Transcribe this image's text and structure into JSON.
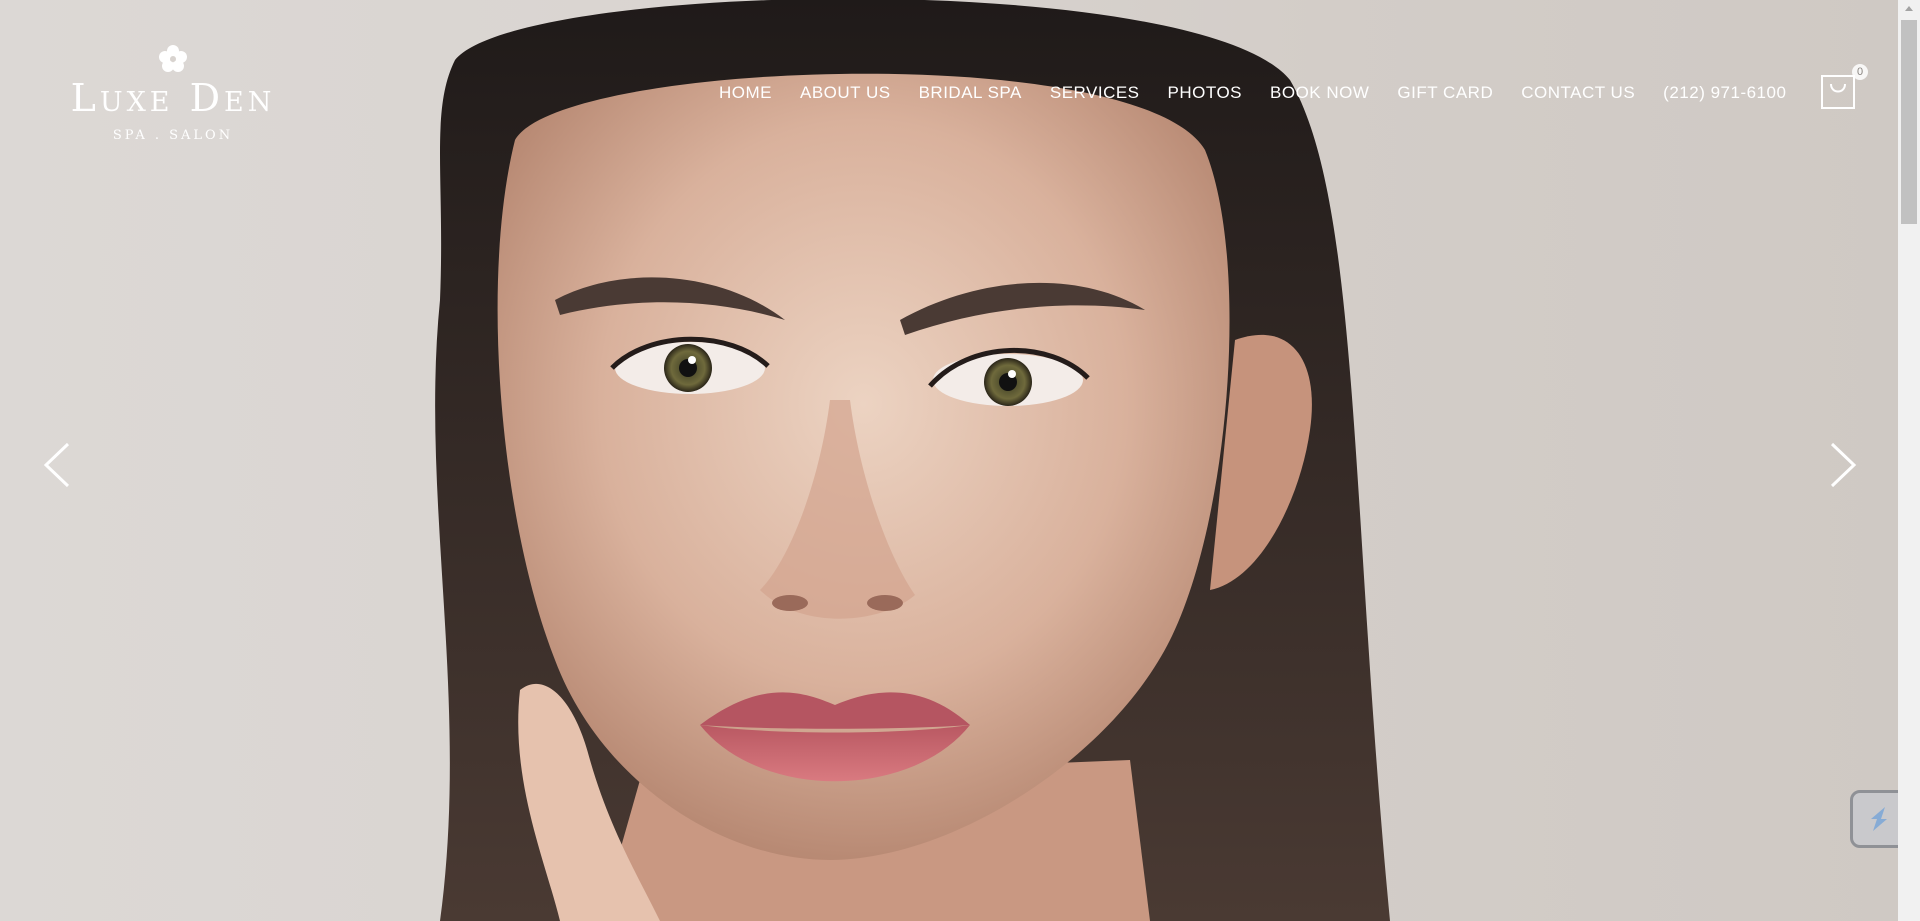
{
  "brand": {
    "name": "Luxe Den",
    "tagline": "SPA . SALON"
  },
  "nav": {
    "items": [
      {
        "label": "HOME"
      },
      {
        "label": "ABOUT US"
      },
      {
        "label": "BRIDAL SPA"
      },
      {
        "label": "SERVICES"
      },
      {
        "label": "PHOTOS"
      },
      {
        "label": "BOOK NOW"
      },
      {
        "label": "GIFT CARD"
      },
      {
        "label": "CONTACT US"
      },
      {
        "label": "(212) 971-6100"
      }
    ]
  },
  "cart": {
    "count": "0",
    "icon": "shopping-bag-icon"
  },
  "slider": {
    "prev_icon": "chevron-left-icon",
    "next_icon": "chevron-right-icon"
  },
  "widget": {
    "icon": "chat-widget-icon"
  },
  "colors": {
    "nav_text": "#ffffff",
    "background": "#d8d3cf",
    "lips": "#c7646b",
    "hair": "#2e2624"
  }
}
